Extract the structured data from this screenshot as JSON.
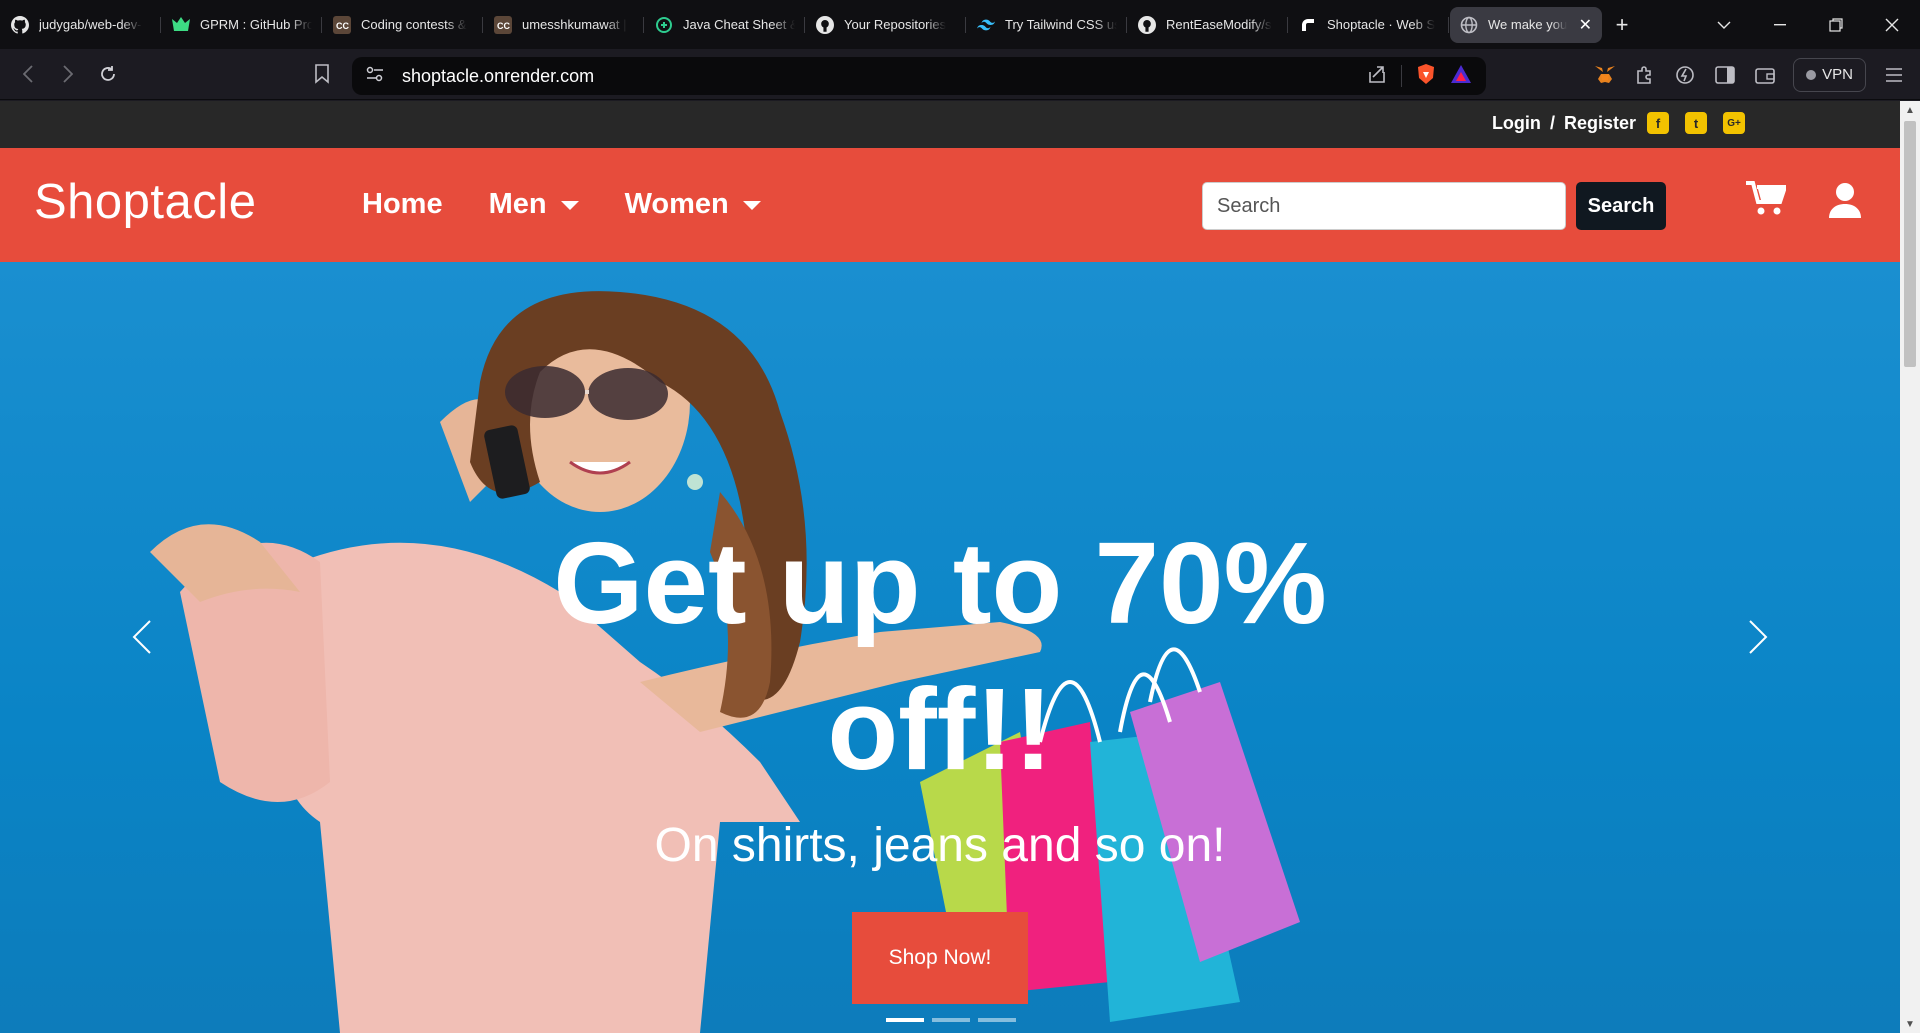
{
  "browser": {
    "tabs": [
      {
        "title": "judygab/web-dev-",
        "icon": "github-icon"
      },
      {
        "title": "GPRM : GitHub Pro",
        "icon": "gprm-icon"
      },
      {
        "title": "Coding contests &",
        "icon": "codechef-icon"
      },
      {
        "title": "umesshkumawat |",
        "icon": "codechef-icon"
      },
      {
        "title": "Java Cheat Sheet &",
        "icon": "codecademy-icon"
      },
      {
        "title": "Your Repositories",
        "icon": "github-icon"
      },
      {
        "title": "Try Tailwind CSS us",
        "icon": "tailwind-icon"
      },
      {
        "title": "RentEaseModify/s",
        "icon": "github-icon"
      },
      {
        "title": "Shoptacle · Web S",
        "icon": "render-icon"
      },
      {
        "title": "We make you",
        "icon": "globe-icon",
        "active": true
      }
    ],
    "url": "shoptacle.onrender.com",
    "vpn_label": "VPN"
  },
  "site": {
    "login_label": "Login",
    "slash": "/",
    "register_label": "Register",
    "social": [
      "f",
      "t",
      "G+"
    ],
    "brand": "Shoptacle",
    "nav": [
      {
        "label": "Home",
        "dropdown": false
      },
      {
        "label": "Men",
        "dropdown": true
      },
      {
        "label": "Women",
        "dropdown": true
      }
    ],
    "search_placeholder": "Search",
    "search_button": "Search",
    "accent_color": "#e74c3c",
    "topbar_color": "#282828"
  },
  "hero": {
    "title": "Get up to 70% off!!",
    "subtitle": "On shirts, jeans and so on!",
    "cta": "Shop Now!",
    "slides_total": 3,
    "active_slide": 1
  }
}
